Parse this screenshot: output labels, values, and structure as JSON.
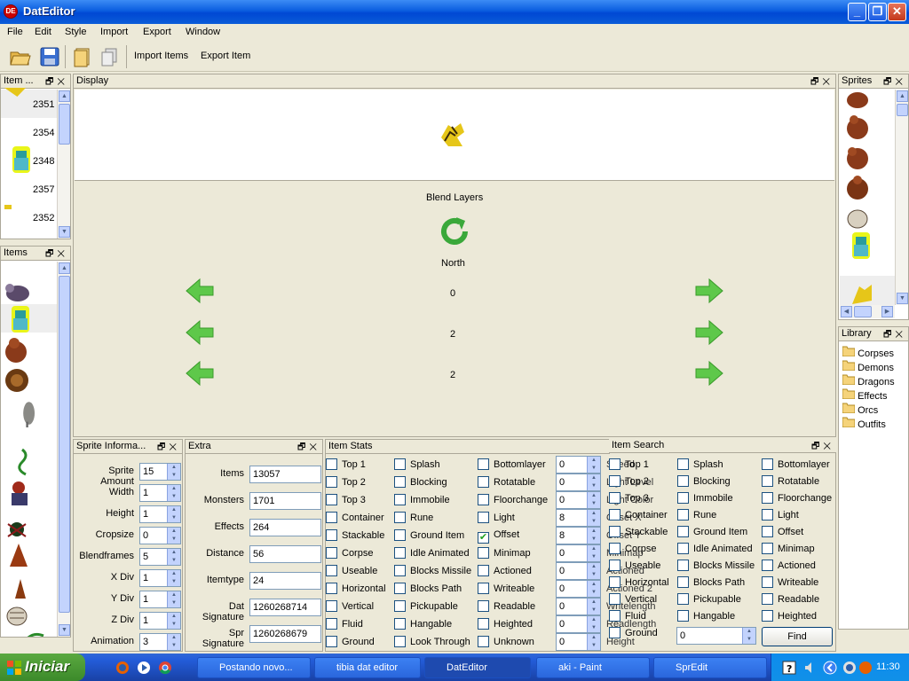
{
  "window": {
    "title": "DatEditor",
    "app_icon": "DE"
  },
  "menu": [
    "File",
    "Edit",
    "Style",
    "Import",
    "Export",
    "Window"
  ],
  "toolbar": {
    "import_items": "Import Items",
    "export_item": "Export Item"
  },
  "item_panel": {
    "title": "Item ...",
    "rows": [
      "2351",
      "2354",
      "2348",
      "2357",
      "2352"
    ]
  },
  "items_panel": {
    "title": "Items"
  },
  "display": {
    "title": "Display",
    "blend_label": "Blend Layers",
    "direction": "North",
    "values": [
      "0",
      "2",
      "2"
    ]
  },
  "sprites_panel": {
    "title": "Sprites"
  },
  "library": {
    "title": "Library",
    "folders": [
      "Corpses",
      "Demons",
      "Dragons",
      "Effects",
      "Orcs",
      "Outfits"
    ]
  },
  "sprite_info": {
    "title": "Sprite Informa...",
    "fields": [
      {
        "label": "Sprite Amount",
        "value": "15"
      },
      {
        "label": "Width",
        "value": "1"
      },
      {
        "label": "Height",
        "value": "1"
      },
      {
        "label": "Cropsize",
        "value": "0"
      },
      {
        "label": "Blendframes",
        "value": "5"
      },
      {
        "label": "X Div",
        "value": "1"
      },
      {
        "label": "Y Div",
        "value": "1"
      },
      {
        "label": "Z Div",
        "value": "1"
      },
      {
        "label": "Animation",
        "value": "3"
      }
    ]
  },
  "extra": {
    "title": "Extra",
    "fields": [
      {
        "label": "Items",
        "value": "13057"
      },
      {
        "label": "Monsters",
        "value": "1701"
      },
      {
        "label": "Effects",
        "value": "264"
      },
      {
        "label": "Distance",
        "value": "56"
      },
      {
        "label": "Itemtype",
        "value": "24"
      },
      {
        "label": "Dat Signature",
        "value": "1260268714"
      },
      {
        "label": "Spr Signature",
        "value": "1260268679"
      }
    ]
  },
  "item_stats": {
    "title": "Item Stats",
    "col1": [
      "Top 1",
      "Top 2",
      "Top 3",
      "Container",
      "Stackable",
      "Corpse",
      "Useable",
      "Horizontal",
      "Vertical",
      "Fluid",
      "Ground"
    ],
    "col2": [
      "Splash",
      "Blocking",
      "Immobile",
      "Rune",
      "Ground Item",
      "Idle Animated",
      "Blocks Missile",
      "Blocks Path",
      "Pickupable",
      "Hangable",
      "Look Through"
    ],
    "col3": [
      "Bottomlayer",
      "Rotatable",
      "Floorchange",
      "Light",
      "Offset",
      "Minimap",
      "Actioned",
      "Writeable",
      "Readable",
      "Heighted",
      "Unknown"
    ],
    "col3_checked": [
      false,
      false,
      false,
      false,
      true,
      false,
      false,
      false,
      false,
      false,
      false
    ],
    "spin_values": [
      "0",
      "0",
      "0",
      "8",
      "8",
      "0",
      "0",
      "0",
      "0",
      "0",
      "0"
    ],
    "overlap_labels": [
      "Speed",
      "Light Level",
      "Light Color",
      "Offset X",
      "Offset Y",
      "Minimap",
      "Actioned",
      "Actioned 2",
      "Writelength",
      "Readlength",
      "Height"
    ]
  },
  "item_search": {
    "title": "Item Search",
    "col1": [
      "Top 1",
      "Top 2",
      "Top 3",
      "Container",
      "Stackable",
      "Corpse",
      "Useable",
      "Horizontal",
      "Vertical",
      "Fluid",
      "Ground"
    ],
    "col2": [
      "Splash",
      "Blocking",
      "Immobile",
      "Rune",
      "Ground Item",
      "Idle Animated",
      "Blocks Missile",
      "Blocks Path",
      "Pickupable",
      "Hangable"
    ],
    "col3": [
      "Bottomlayer",
      "Rotatable",
      "Floorchange",
      "Light",
      "Offset",
      "Minimap",
      "Actioned",
      "Writeable",
      "Readable",
      "Heighted"
    ],
    "search_value": "0",
    "find_label": "Find"
  },
  "taskbar": {
    "start": "Iniciar",
    "tasks": [
      "Postando novo...",
      "tibia dat editor",
      "DatEditor",
      "aki - Paint",
      "SprEdit"
    ],
    "clock": "11:30"
  }
}
